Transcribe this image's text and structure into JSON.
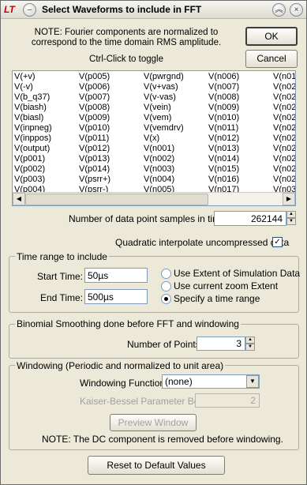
{
  "window": {
    "title": "Select Waveforms to include in FFT",
    "logo": "LT"
  },
  "note_top": "NOTE:  Fourier components are normalized to correspond to the time domain RMS amplitude.",
  "ctrl_click": "Ctrl-Click to toggle",
  "buttons": {
    "ok": "OK",
    "cancel": "Cancel",
    "reset": "Reset to Default Values",
    "preview": "Preview Window"
  },
  "waveforms": {
    "col1": [
      "V(+v)",
      "V(-v)",
      "V(b_q37)",
      "V(biash)",
      "V(biasl)",
      "V(inpneg)",
      "V(inppos)",
      "V(output)",
      "V(p001)",
      "V(p002)",
      "V(p003)",
      "V(p004)"
    ],
    "col2": [
      "V(p005)",
      "V(p006)",
      "V(p007)",
      "V(p008)",
      "V(p009)",
      "V(p010)",
      "V(p011)",
      "V(p012)",
      "V(p013)",
      "V(p014)",
      "V(psrr+)",
      "V(psrr-)"
    ],
    "col3": [
      "V(pwrgnd)",
      "V(v+vas)",
      "V(v-vas)",
      "V(vein)",
      "V(vem)",
      "V(vemdrv)",
      "V(x)",
      "V(n001)",
      "V(n002)",
      "V(n003)",
      "V(n004)",
      "V(n005)"
    ],
    "col4": [
      "V(n006)",
      "V(n007)",
      "V(n008)",
      "V(n009)",
      "V(n010)",
      "V(n011)",
      "V(n012)",
      "V(n013)",
      "V(n014)",
      "V(n015)",
      "V(n016)",
      "V(n017)"
    ],
    "col5": [
      "V(n01",
      "V(n02",
      "V(n02",
      "V(n02",
      "V(n02",
      "V(n02",
      "V(n02",
      "V(n02",
      "V(n02",
      "V(n02",
      "V(n02",
      "V(n03"
    ]
  },
  "samples": {
    "label": "Number of data point samples in time:",
    "value": "262144"
  },
  "quadratic": {
    "label": "Quadratic interpolate uncompressed data",
    "checked": true,
    "mark": "✓"
  },
  "time_range": {
    "group_label": "Time range to include",
    "start_label": "Start Time:",
    "start_value": "50µs",
    "end_label": "End Time:",
    "end_value": "500µs",
    "options": [
      "Use Extent of Simulation Data",
      "Use current zoom Extent",
      "Specify a time range"
    ],
    "selected_index": 2
  },
  "binomial": {
    "group_label": "Binomial Smoothing done before FFT and windowing",
    "points_label": "Number of Points:",
    "points_value": "3"
  },
  "windowing": {
    "group_label": "Windowing  (Periodic and normalized to unit area)",
    "function_label": "Windowing Function:",
    "function_value": "(none)",
    "beta_label": "Kaiser-Bessel Parameter Beta:",
    "beta_value": "2",
    "note": "NOTE:  The DC component is removed before windowing."
  }
}
